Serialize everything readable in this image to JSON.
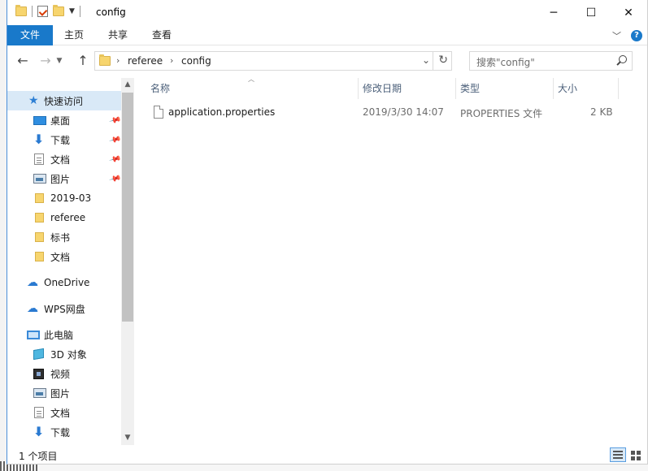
{
  "window": {
    "title": "config",
    "controls": {
      "minimize": "─",
      "maximize": "☐",
      "close": "✕"
    }
  },
  "ribbon": {
    "tabs": [
      "文件",
      "主页",
      "共享",
      "查看"
    ],
    "expand_symbol": "﹀",
    "help_symbol": "?"
  },
  "address": {
    "breadcrumb": [
      "referee",
      "config"
    ],
    "separator": "›"
  },
  "search": {
    "placeholder": "搜索\"config\""
  },
  "nav": {
    "items": [
      {
        "label": "快速访问",
        "icon": "star-icon"
      },
      {
        "label": "桌面",
        "icon": "desktop-icon",
        "pinned": true
      },
      {
        "label": "下载",
        "icon": "download-icon",
        "pinned": true
      },
      {
        "label": "文档",
        "icon": "document-icon",
        "pinned": true
      },
      {
        "label": "图片",
        "icon": "picture-icon",
        "pinned": true
      },
      {
        "label": "2019-03",
        "icon": "folder-icon"
      },
      {
        "label": "referee",
        "icon": "folder-icon"
      },
      {
        "label": "标书",
        "icon": "folder-icon"
      },
      {
        "label": "文档",
        "icon": "folder-icon"
      },
      {
        "label": "OneDrive",
        "icon": "cloud-icon"
      },
      {
        "label": "WPS网盘",
        "icon": "wps-cloud-icon"
      },
      {
        "label": "此电脑",
        "icon": "computer-icon"
      },
      {
        "label": "3D 对象",
        "icon": "3d-objects-icon"
      },
      {
        "label": "视频",
        "icon": "video-icon"
      },
      {
        "label": "图片",
        "icon": "picture-icon"
      },
      {
        "label": "文档",
        "icon": "document-icon"
      },
      {
        "label": "下载",
        "icon": "download-icon"
      }
    ]
  },
  "columns": {
    "name": "名称",
    "modified": "修改日期",
    "type": "类型",
    "size": "大小"
  },
  "files": [
    {
      "name": "application.properties",
      "modified": "2019/3/30 14:07",
      "type": "PROPERTIES 文件",
      "size": "2 KB"
    }
  ],
  "status": {
    "item_count": "1 个项目"
  },
  "colors": {
    "accent": "#1979ca",
    "selection": "#d9e9f7",
    "folder": "#f7d56e",
    "header_text": "#4c607a"
  }
}
